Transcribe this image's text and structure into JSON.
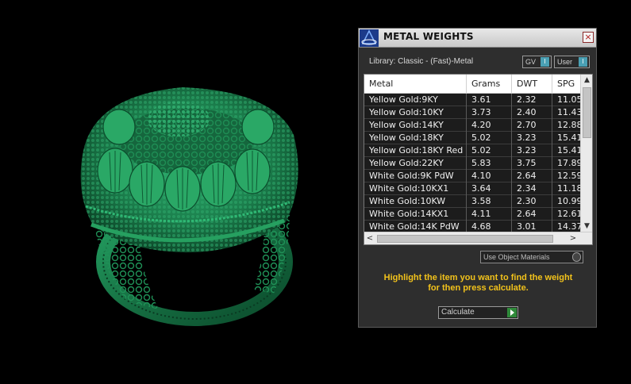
{
  "window": {
    "title": "METAL WEIGHTS",
    "close": "×"
  },
  "library": {
    "label": "Library: Classic - (Fast)-Metal"
  },
  "toggles": {
    "gv_label": "GV",
    "user_label": "User",
    "indicator": "I"
  },
  "table": {
    "columns": [
      "Metal",
      "Grams",
      "DWT",
      "SPG"
    ],
    "rows": [
      [
        "Yellow Gold:9KY",
        "3.61",
        "2.32",
        "11.05"
      ],
      [
        "Yellow Gold:10KY",
        "3.73",
        "2.40",
        "11.43"
      ],
      [
        "Yellow Gold:14KY",
        "4.20",
        "2.70",
        "12.88"
      ],
      [
        "Yellow Gold:18KY",
        "5.02",
        "3.23",
        "15.41"
      ],
      [
        "Yellow Gold:18KY Red",
        "5.02",
        "3.23",
        "15.41"
      ],
      [
        "Yellow Gold:22KY",
        "5.83",
        "3.75",
        "17.89"
      ],
      [
        "White Gold:9K PdW",
        "4.10",
        "2.64",
        "12.59"
      ],
      [
        "White Gold:10KX1",
        "3.64",
        "2.34",
        "11.18"
      ],
      [
        "White Gold:10KW",
        "3.58",
        "2.30",
        "10.99"
      ],
      [
        "White Gold:14KX1",
        "4.11",
        "2.64",
        "12.61"
      ],
      [
        "White Gold:14K PdW",
        "4.68",
        "3.01",
        "14.37"
      ]
    ]
  },
  "scroll": {
    "up": "▲",
    "down": "▼",
    "left": "<",
    "right": ">"
  },
  "use_object_materials": {
    "label": "Use Object Materials"
  },
  "hint": {
    "line1": "Highlight the item you want to find the weight",
    "line2": "for then press calculate."
  },
  "calculate": {
    "label": "Calculate"
  },
  "colors": {
    "ring": "#1f8a55",
    "hint": "#f2c21b",
    "accent": "#4aa0b4"
  }
}
